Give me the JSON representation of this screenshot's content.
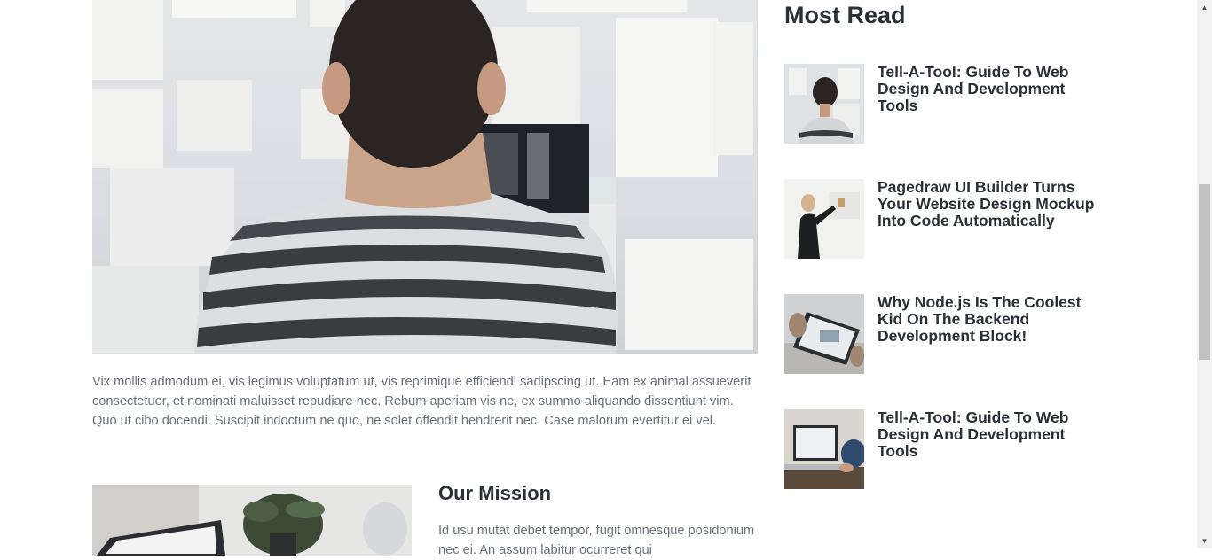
{
  "article": {
    "intro": "Vix mollis admodum ei, vis legimus voluptatum ut, vis reprimique efficiendi sadipscing ut. Eam ex animal assueverit consectetuer, et nominati maluisset repudiare nec. Rebum aperiam vis ne, ex summo aliquando dissentiunt vim. Quo ut cibo docendi. Suscipit indoctum ne quo, ne solet offendit hendrerit nec. Case malorum evertitur ei vel.",
    "mission_title": "Our Mission",
    "mission_text": "Id usu mutat debet tempor, fugit omnesque posidonium nec ei. An assum labitur ocurreret qui"
  },
  "sidebar": {
    "title": "Most Read",
    "posts": [
      {
        "title": "Tell-A-Tool: Guide To Web Design And Development Tools",
        "thumb": "man-at-moodboard"
      },
      {
        "title": "Pagedraw UI Builder Turns Your Website Design Mockup Into Code Automatically",
        "thumb": "man-at-whiteboard"
      },
      {
        "title": "Why Node.js Is The Coolest Kid On The Backend Development Block!",
        "thumb": "hands-with-tablet"
      },
      {
        "title": "Tell-A-Tool: Guide To Web Design And Development Tools",
        "thumb": "laptop-on-desk"
      }
    ]
  },
  "scrollbar": {
    "up_icon": "▲",
    "down_icon": "▼"
  }
}
